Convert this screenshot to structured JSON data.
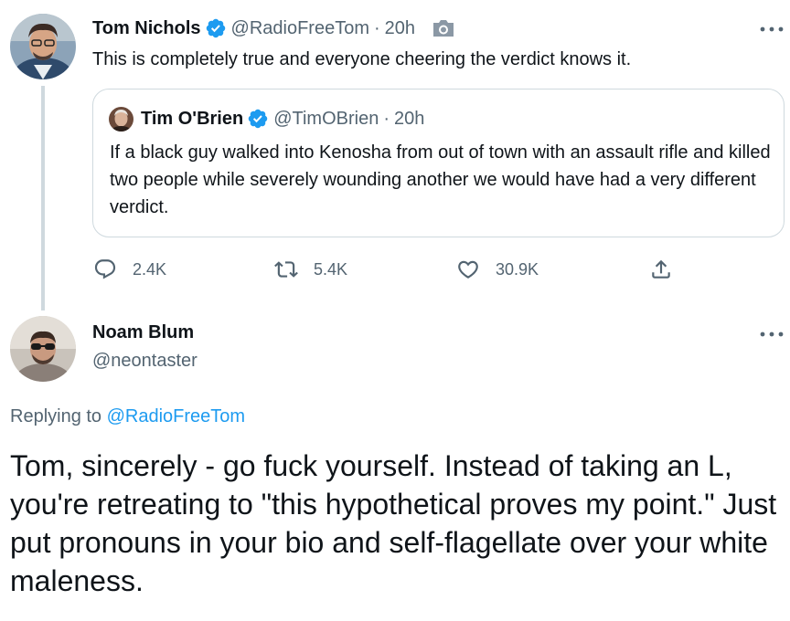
{
  "parent": {
    "display_name": "Tom Nichols",
    "handle": "@RadioFreeTom",
    "separator": "·",
    "time": "20h",
    "text": "This is completely true and everyone cheering the verdict knows it.",
    "media_icon": "camera-icon",
    "verified": true
  },
  "quote": {
    "display_name": "Tim O'Brien",
    "handle": "@TimOBrien",
    "separator": "·",
    "time": "20h",
    "text": "If a black guy walked into Kenosha from out of town with an assault rifle and killed two people while severely wounding another we would have had a very different verdict.",
    "verified": true
  },
  "actions": {
    "replies": "2.4K",
    "retweets": "5.4K",
    "likes": "30.9K"
  },
  "reply": {
    "display_name": "Noam Blum",
    "handle": "@neontaster",
    "replying_label": "Replying to",
    "replying_mention": "@RadioFreeTom",
    "text": "Tom, sincerely - go fuck yourself. Instead of taking an L, you're retreating to \"this hypothetical proves my point.\" Just put pronouns in your bio and self-flagellate over your white maleness."
  },
  "colors": {
    "accent": "#1d9bf0",
    "muted_text": "#536471",
    "primary_text": "#0f1419",
    "border": "#cfd9de"
  }
}
